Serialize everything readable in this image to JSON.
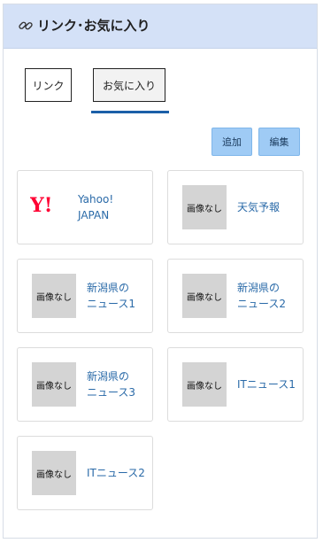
{
  "header": {
    "title": "リンク･お気に入り",
    "icon": "link-icon"
  },
  "tabs": [
    {
      "label": "リンク",
      "active": false
    },
    {
      "label": "お気に入り",
      "active": true
    }
  ],
  "actions": {
    "add_label": "追加",
    "edit_label": "編集"
  },
  "favorites": [
    {
      "label": "Yahoo!\nJAPAN",
      "thumbnail": "yahoo-logo",
      "logo_text": "Y!"
    },
    {
      "label": "天気予報",
      "thumbnail": "画像なし"
    },
    {
      "label": "新潟県の\nニュース1",
      "thumbnail": "画像なし"
    },
    {
      "label": "新潟県の\nニュース2",
      "thumbnail": "画像なし"
    },
    {
      "label": "新潟県の\nニュース3",
      "thumbnail": "画像なし"
    },
    {
      "label": "ITニュース1",
      "thumbnail": "画像なし"
    },
    {
      "label": "ITニュース2",
      "thumbnail": "画像なし"
    }
  ],
  "colors": {
    "header_bg": "#d4e1f7",
    "accent": "#1b5fa8",
    "button_bg": "#9fcbf5",
    "link_text": "#2a6aa8",
    "yahoo_red": "#ff0033"
  }
}
